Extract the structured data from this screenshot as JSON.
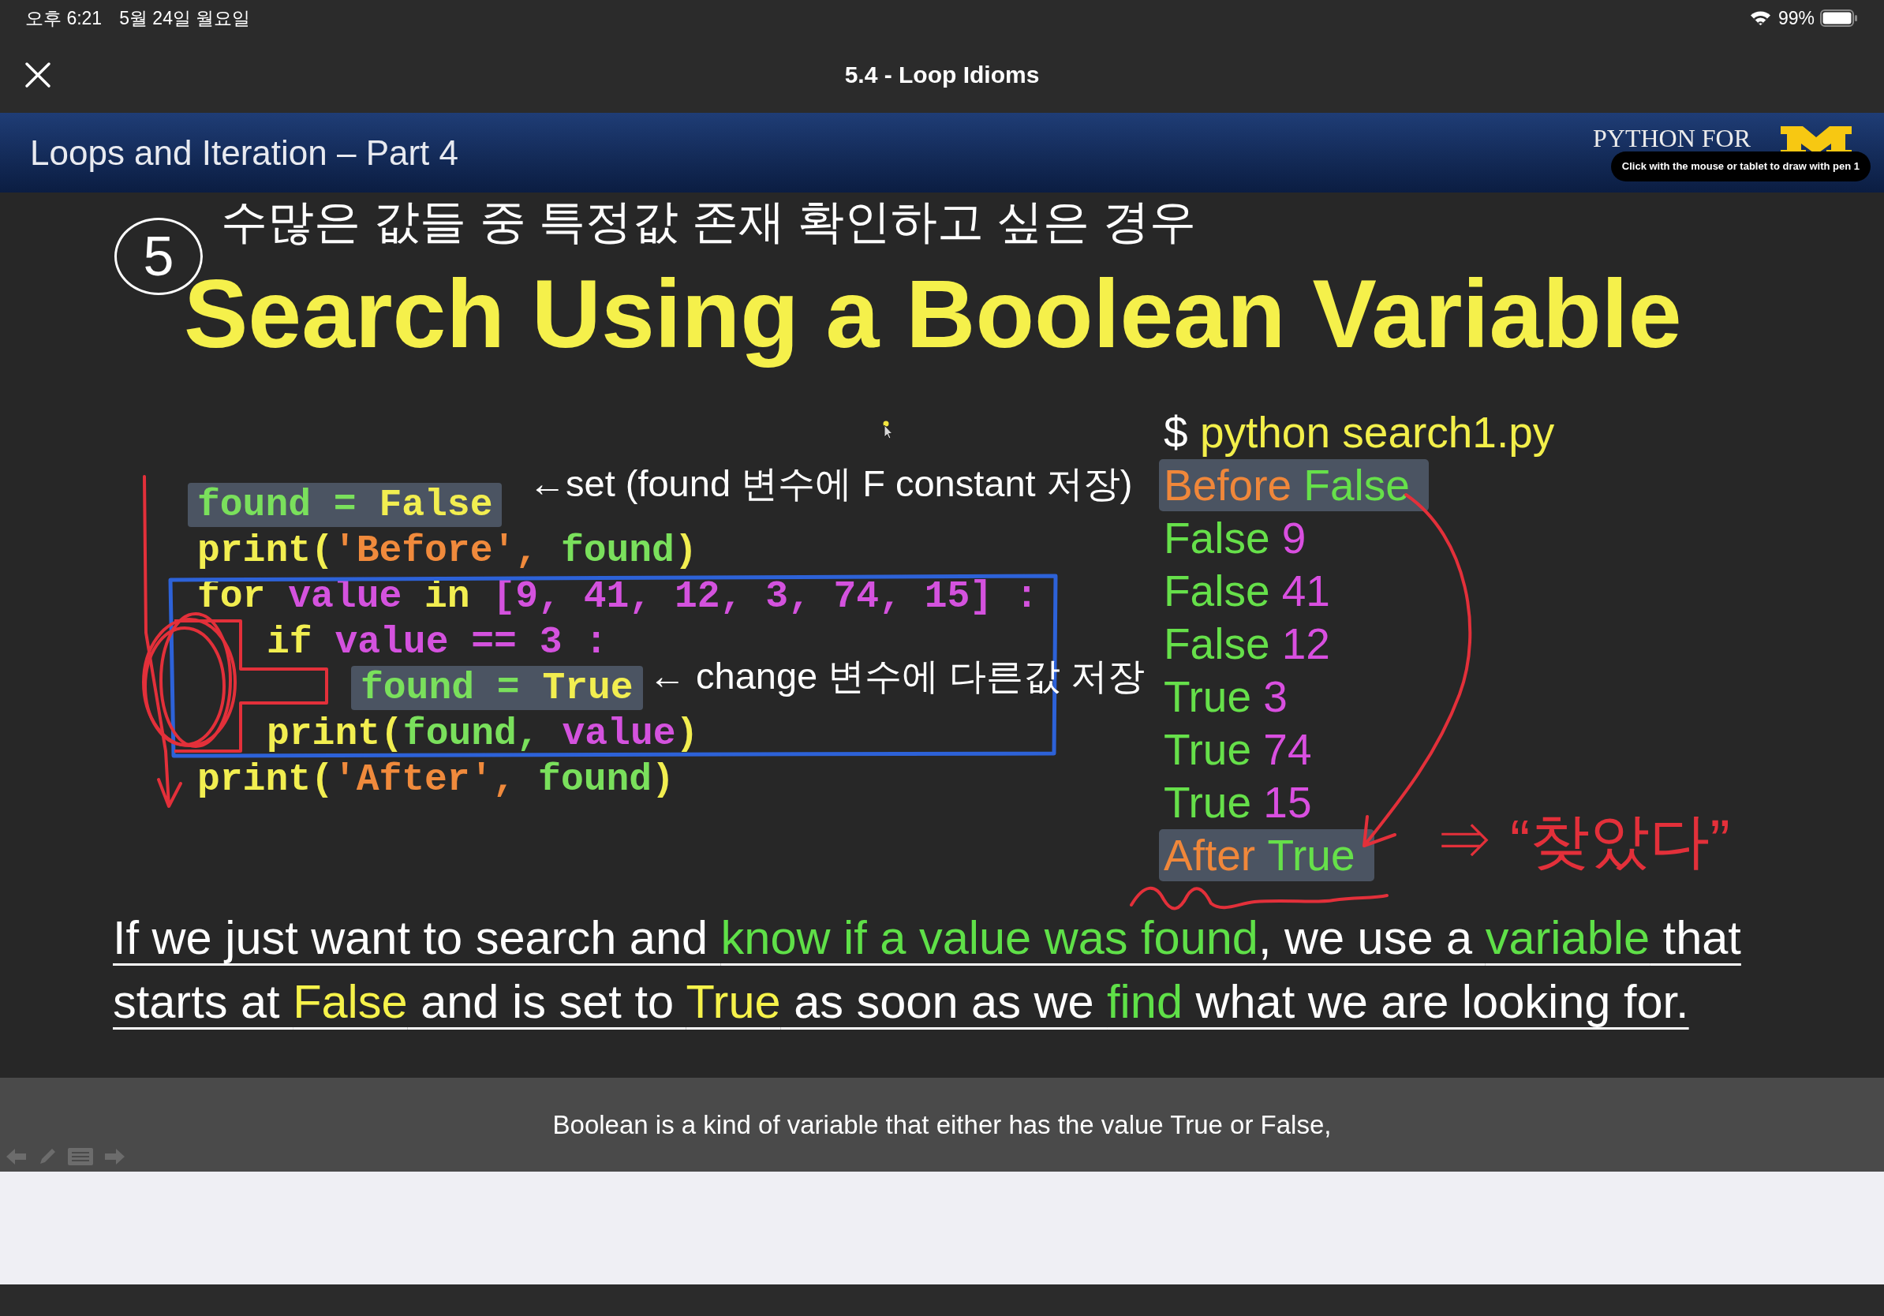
{
  "status_bar": {
    "time": "오후 6:21",
    "date": "5월 24일 월요일",
    "battery": "99%"
  },
  "player": {
    "title": "5.4 - Loop Idioms",
    "caption": "Boolean is a kind of variable that either has the value True or False,"
  },
  "slide": {
    "header": {
      "title": "Loops and Iteration – Part 4",
      "logo_text": "PYTHON FOR"
    },
    "pen_tooltip": "Click with the mouse or tablet to draw with pen 1",
    "title": "Search Using a Boolean Variable",
    "code": [
      {
        "highlighted": true,
        "tokens": [
          {
            "text": "found = ",
            "color": "#7ae05c"
          },
          {
            "text": "False",
            "color": "#f2ee50"
          }
        ]
      },
      {
        "highlighted": false,
        "tokens": [
          {
            "text": "print(",
            "color": "#f2ee50"
          },
          {
            "text": "'Before', ",
            "color": "#f08a3c"
          },
          {
            "text": "found",
            "color": "#7ae05c"
          },
          {
            "text": ")",
            "color": "#f2ee50"
          }
        ]
      },
      {
        "highlighted": false,
        "tokens": [
          {
            "text": "for ",
            "color": "#f2ee50"
          },
          {
            "text": "value ",
            "color": "#d452de"
          },
          {
            "text": "in ",
            "color": "#f2ee50"
          },
          {
            "text": "[9, 41, 12, 3, 74, 15] :",
            "color": "#d452de"
          }
        ],
        "children": [
          {
            "highlighted": false,
            "tokens": [
              {
                "text": "if ",
                "color": "#f2ee50"
              },
              {
                "text": "value == 3 :",
                "color": "#d452de"
              }
            ],
            "children": [
              {
                "highlighted": true,
                "tokens": [
                  {
                    "text": "found = ",
                    "color": "#7ae05c"
                  },
                  {
                    "text": "True",
                    "color": "#f2ee50"
                  }
                ]
              }
            ]
          },
          {
            "highlighted": false,
            "tokens": [
              {
                "text": "print(",
                "color": "#f2ee50"
              },
              {
                "text": "found, ",
                "color": "#7ae05c"
              },
              {
                "text": "value",
                "color": "#d452de"
              },
              {
                "text": ")",
                "color": "#f2ee50"
              }
            ]
          }
        ]
      },
      {
        "highlighted": false,
        "tokens": [
          {
            "text": "print(",
            "color": "#f2ee50"
          },
          {
            "text": "'After', ",
            "color": "#f08a3c"
          },
          {
            "text": "found",
            "color": "#7ae05c"
          },
          {
            "text": ")",
            "color": "#f2ee50"
          }
        ]
      }
    ],
    "terminal": [
      {
        "highlighted": false,
        "tokens": [
          {
            "text": "$ ",
            "color": "#ffffff"
          },
          {
            "text": "python search1.py",
            "color": "#f3ef4a"
          }
        ]
      },
      {
        "highlighted": true,
        "tokens": [
          {
            "text": "Before ",
            "color": "#f0873a"
          },
          {
            "text": "False",
            "color": "#66e04a"
          }
        ]
      },
      {
        "highlighted": false,
        "tokens": [
          {
            "text": "False ",
            "color": "#66e04a"
          },
          {
            "text": "9",
            "color": "#d94fe0"
          }
        ]
      },
      {
        "highlighted": false,
        "tokens": [
          {
            "text": "False ",
            "color": "#66e04a"
          },
          {
            "text": "41",
            "color": "#d94fe0"
          }
        ]
      },
      {
        "highlighted": false,
        "tokens": [
          {
            "text": "False ",
            "color": "#66e04a"
          },
          {
            "text": "12",
            "color": "#d94fe0"
          }
        ]
      },
      {
        "highlighted": false,
        "tokens": [
          {
            "text": "True ",
            "color": "#66e04a"
          },
          {
            "text": "3",
            "color": "#d94fe0"
          }
        ]
      },
      {
        "highlighted": false,
        "tokens": [
          {
            "text": "True ",
            "color": "#66e04a"
          },
          {
            "text": "74",
            "color": "#d94fe0"
          }
        ]
      },
      {
        "highlighted": false,
        "tokens": [
          {
            "text": "True ",
            "color": "#66e04a"
          },
          {
            "text": "15",
            "color": "#d94fe0"
          }
        ]
      },
      {
        "highlighted": true,
        "tokens": [
          {
            "text": "After ",
            "color": "#f0873a"
          },
          {
            "text": "True",
            "color": "#66e04a"
          }
        ]
      }
    ],
    "paragraph": [
      [
        {
          "text": "If we just want to search and ",
          "color": "#ffffff"
        },
        {
          "text": "know if a value was found",
          "color": "#5fe048"
        },
        {
          "text": ", we use a ",
          "color": "#ffffff"
        },
        {
          "text": "variable",
          "color": "#5fe048"
        },
        {
          "text": " that",
          "color": "#ffffff"
        }
      ],
      [
        {
          "text": "starts at ",
          "color": "#ffffff"
        },
        {
          "text": "False",
          "color": "#f6f24a"
        },
        {
          "text": " and is set to ",
          "color": "#ffffff"
        },
        {
          "text": "True",
          "color": "#f6f24a"
        },
        {
          "text": " as soon as we ",
          "color": "#ffffff"
        },
        {
          "text": "find",
          "color": "#5fe048"
        },
        {
          "text": " what we are looking for.",
          "color": "#ffffff"
        }
      ]
    ],
    "handwritten_notes": [
      {
        "kind": "numbered",
        "number": "5",
        "text": "수많은 값들 중 특정값 존재 확인하고 싶은 경우"
      },
      {
        "kind": "note",
        "text": "←set (found 변수에 F constant 저장)"
      },
      {
        "kind": "note",
        "text": "← change 변수에 다른값 저장"
      },
      {
        "kind": "exclaim",
        "text": "⇒ “찾았다”"
      }
    ]
  }
}
